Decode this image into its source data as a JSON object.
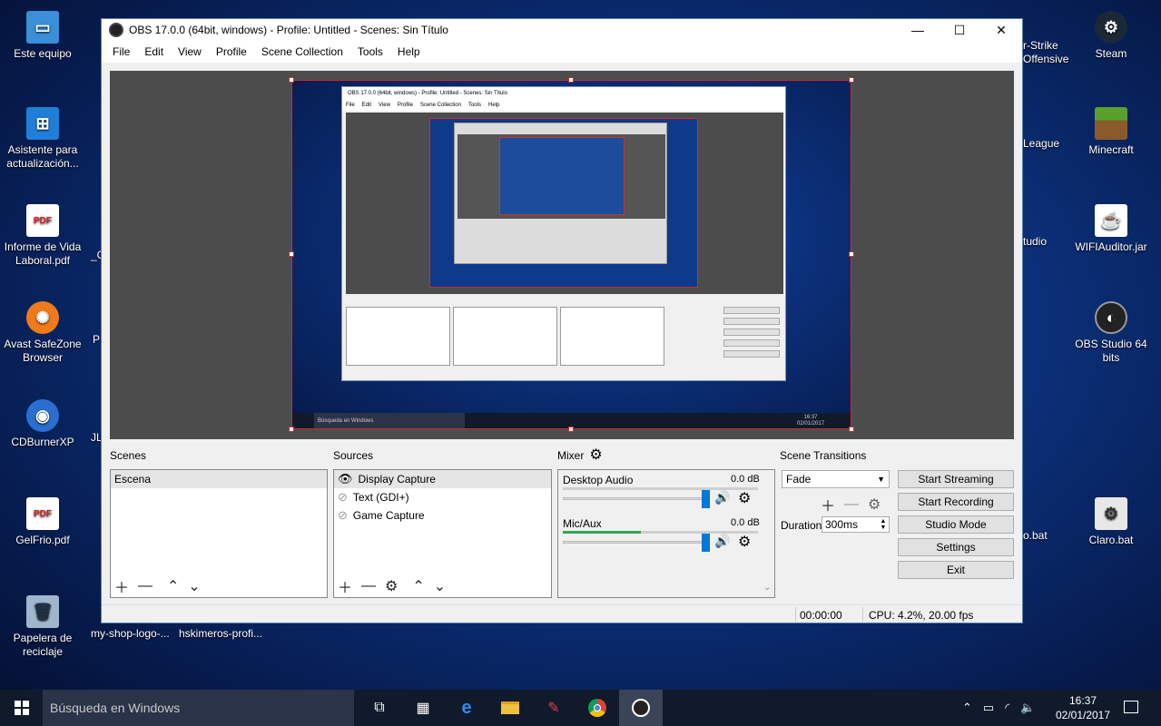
{
  "desktop": {
    "left_icons": [
      {
        "label": "Este equipo"
      },
      {
        "label": "Asistente para actualización..."
      },
      {
        "label": "Informe de Vida Laboral.pdf"
      },
      {
        "label": "Avast SafeZone Browser"
      },
      {
        "label": "CDBurnerXP"
      },
      {
        "label": "GelFrio.pdf"
      },
      {
        "label": "Papelera de reciclaje"
      }
    ],
    "right_icons": [
      {
        "label": "Steam"
      },
      {
        "label": "Minecraft"
      },
      {
        "label": "WIFIAuditor.jar"
      },
      {
        "label": "OBS Studio 64 bits"
      },
      {
        "label": "Claro.bat"
      }
    ],
    "partial_labels": [
      "r-Strike",
      "Offensive",
      "League",
      "tudio",
      "o.bat",
      "my-shop-logo-...",
      "hskimeros-profi...",
      "_C",
      "JL",
      "P"
    ]
  },
  "window": {
    "title": "OBS 17.0.0 (64bit, windows) - Profile: Untitled - Scenes: Sin Título",
    "menu": [
      "File",
      "Edit",
      "View",
      "Profile",
      "Scene Collection",
      "Tools",
      "Help"
    ]
  },
  "scenes": {
    "title": "Scenes",
    "items": [
      "Escena"
    ]
  },
  "sources": {
    "title": "Sources",
    "items": [
      "Display Capture",
      "Text (GDI+)",
      "Game Capture"
    ]
  },
  "mixer": {
    "title": "Mixer",
    "channels": [
      {
        "name": "Desktop Audio",
        "db": "0.0 dB"
      },
      {
        "name": "Mic/Aux",
        "db": "0.0 dB"
      }
    ]
  },
  "transitions": {
    "title": "Scene Transitions",
    "selected": "Fade",
    "duration_label": "Duration",
    "duration_value": "300ms"
  },
  "controls": [
    "Start Streaming",
    "Start Recording",
    "Studio Mode",
    "Settings",
    "Exit"
  ],
  "status": {
    "time": "00:00:00",
    "cpu": "CPU: 4.2%, 20.00 fps"
  },
  "nested": {
    "title": "OBS 17.0.0 (64bit, windows) - Profile: Untitled - Scenes: Sin Título",
    "menu": [
      "File",
      "Edit",
      "View",
      "Profile",
      "Scene Collection",
      "Tools",
      "Help"
    ],
    "taskbar_search": "Búsqueda en Windows",
    "clock_time": "16:37",
    "clock_date": "02/01/2017"
  },
  "taskbar": {
    "search_placeholder": "Búsqueda en Windows",
    "time": "16:37",
    "date": "02/01/2017",
    "accent": "#0078d7"
  }
}
